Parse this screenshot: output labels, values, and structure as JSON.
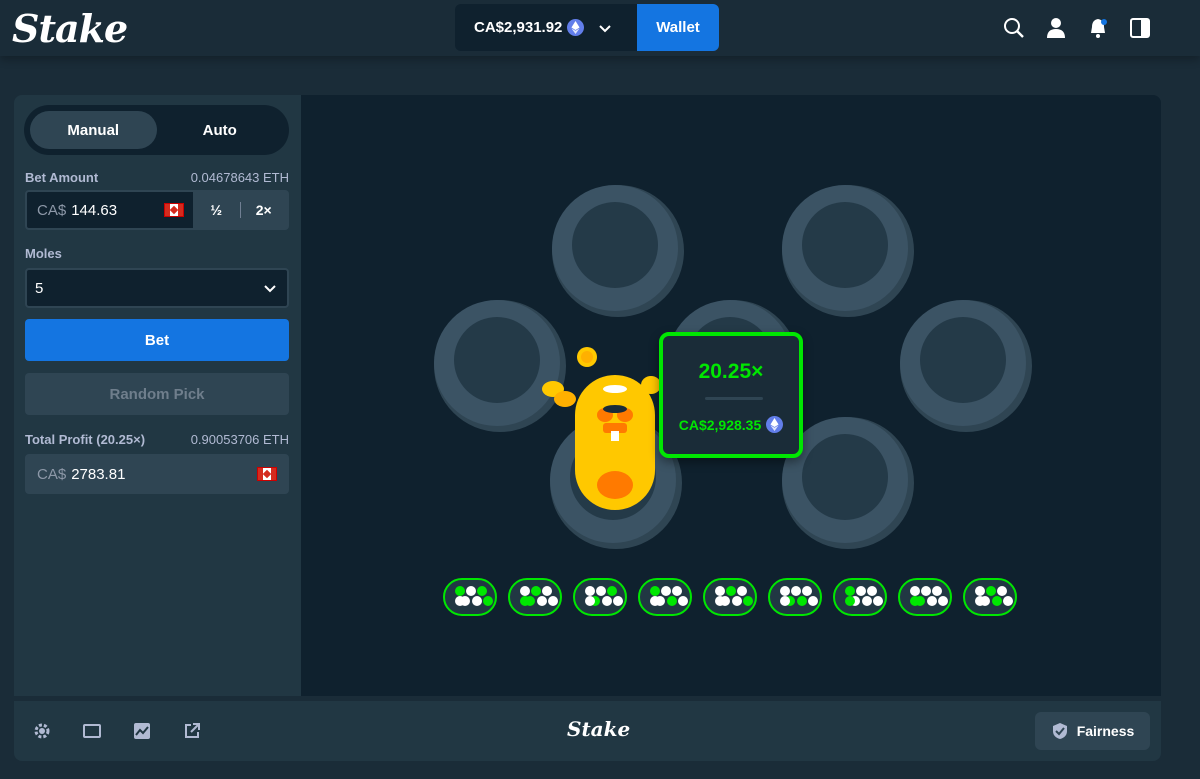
{
  "header": {
    "logo": "Stake",
    "balance": "CA$2,931.92",
    "wallet_label": "Wallet",
    "icons": [
      "search-icon",
      "user-icon",
      "notification-bell-icon",
      "sidebar-toggle-icon"
    ]
  },
  "sidebar": {
    "tabs": [
      {
        "label": "Manual",
        "active": true
      },
      {
        "label": "Auto",
        "active": false
      }
    ],
    "bet_amount": {
      "label": "Bet Amount",
      "crypto_value": "0.04678643 ETH",
      "currency": "CA$",
      "value": "144.63",
      "half_label": "½",
      "double_label": "2×"
    },
    "moles": {
      "label": "Moles",
      "selected": "5"
    },
    "bet_label": "Bet",
    "random_pick_label": "Random Pick",
    "total_profit": {
      "label": "Total Profit (20.25×)",
      "crypto_value": "0.90053706 ETH",
      "currency": "CA$",
      "value": "2783.81"
    }
  },
  "game": {
    "result": {
      "multiplier": "20.25×",
      "payout": "CA$2,928.35"
    },
    "history_count": 9
  },
  "footer": {
    "logo": "Stake",
    "fairness_label": "Fairness",
    "icons": [
      "settings-icon",
      "theatre-mode-icon",
      "stats-icon",
      "popout-icon"
    ]
  },
  "colors": {
    "accent_blue": "#1475e1",
    "win_green": "#00e701",
    "panel": "#213743",
    "game_bg": "#0f212e",
    "eth": "#627eea"
  }
}
